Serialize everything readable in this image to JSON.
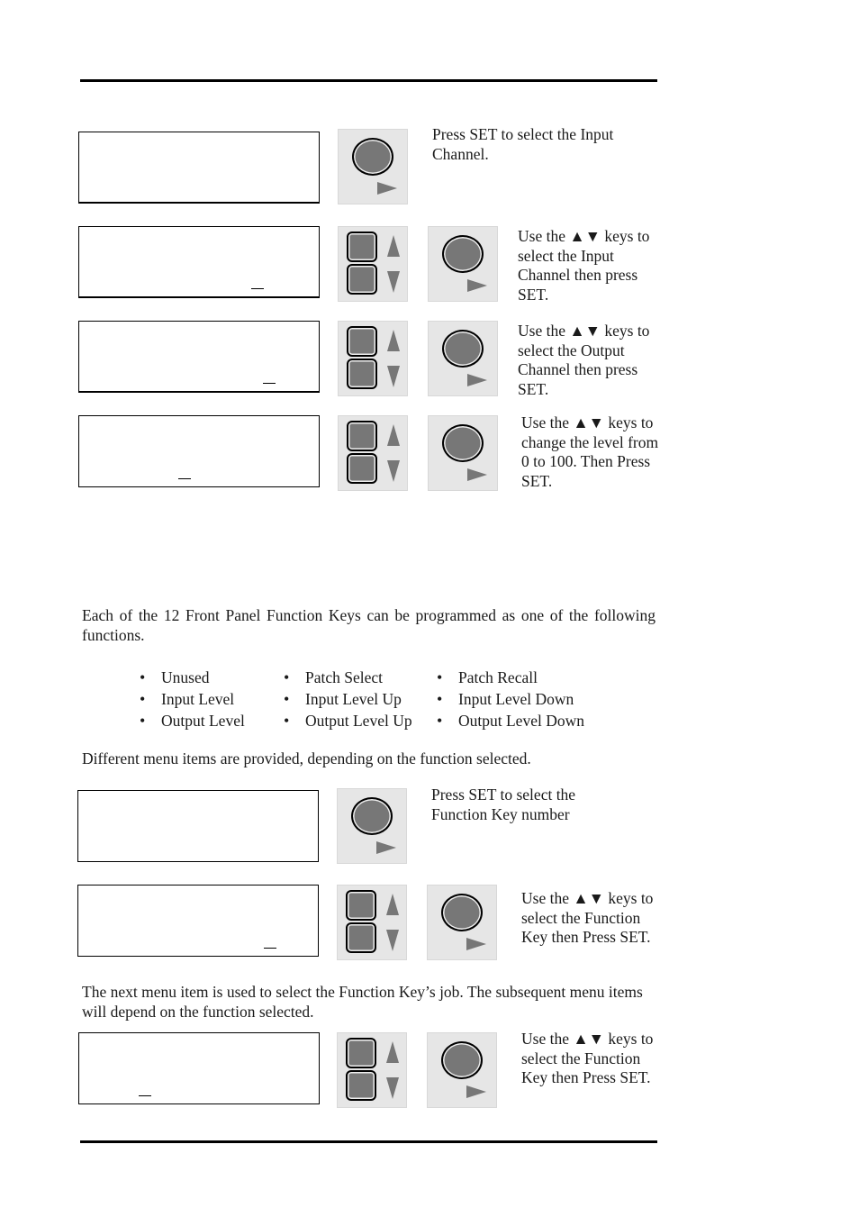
{
  "steps_top": [
    {
      "note": "Press SET to select the Input\nChannel.",
      "keys": [
        "set"
      ]
    },
    {
      "note": "Use the ▲▼ keys to\nselect the Input\nChannel then press\nSET.",
      "keys": [
        "updown",
        "set"
      ]
    },
    {
      "note": "Use the ▲▼ keys to\nselect the Output\nChannel then press\nSET.",
      "keys": [
        "updown",
        "set"
      ]
    },
    {
      "note": "Use the ▲▼ keys to\nchange the level from\n0 to 100. Then Press\nSET.",
      "keys": [
        "updown",
        "set"
      ]
    }
  ],
  "intro_paragraph": "Each of the 12 Front Panel Function Keys can be programmed as one of the following functions.",
  "functions": [
    [
      "Unused",
      "Input Level",
      "Output Level"
    ],
    [
      "Patch Select",
      "Input Level Up",
      "Output Level Up"
    ],
    [
      "Patch Recall",
      "Input Level Down",
      "Output Level Down"
    ]
  ],
  "menu_paragraph": "Different menu items are provided, depending on the function selected.",
  "steps_bottom": [
    {
      "note": "Press SET to select the\nFunction Key number",
      "keys": [
        "set"
      ]
    },
    {
      "note": "Use the ▲▼ keys to\nselect the Function\nKey then Press SET.",
      "keys": [
        "updown",
        "set"
      ]
    }
  ],
  "job_paragraph": "The next menu item is used to select the Function Key’s job. The subsequent menu items will depend on the function selected.",
  "steps_final": [
    {
      "note": "Use the ▲▼ keys to\nselect the Function\nKey then Press SET.",
      "keys": [
        "updown",
        "set"
      ]
    }
  ]
}
